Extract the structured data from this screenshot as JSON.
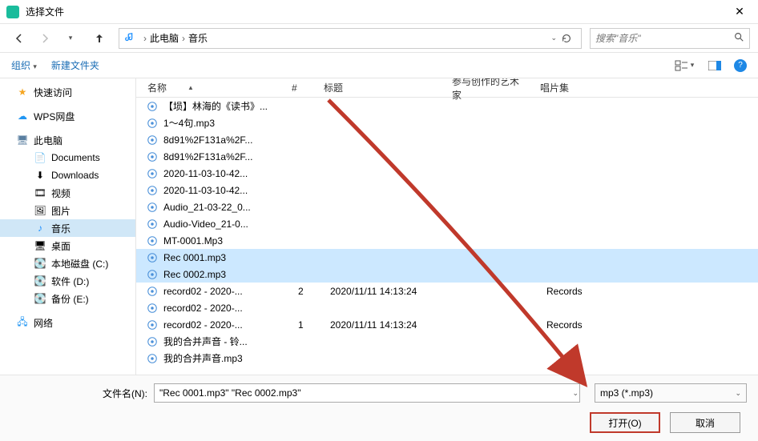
{
  "window": {
    "title": "选择文件"
  },
  "breadcrumb": {
    "root": "此电脑",
    "folder": "音乐"
  },
  "search": {
    "placeholder": "搜索\"音乐\""
  },
  "toolbar": {
    "organize": "组织",
    "newfolder": "新建文件夹"
  },
  "sidebar": {
    "quickaccess": "快速访问",
    "wps": "WPS网盘",
    "thispc": "此电脑",
    "documents": "Documents",
    "downloads": "Downloads",
    "videos": "视频",
    "pictures": "图片",
    "music": "音乐",
    "desktop": "桌面",
    "diskc": "本地磁盘 (C:)",
    "diskd": "软件 (D:)",
    "diske": "备份 (E:)",
    "network": "网络"
  },
  "columns": {
    "name": "名称",
    "num": "#",
    "title": "标题",
    "artist": "参与创作的艺术家",
    "album": "唱片集"
  },
  "files": [
    {
      "name": "【埙】林海的《读书》...",
      "num": "",
      "title": "",
      "album": "",
      "sel": false
    },
    {
      "name": "1～4句.mp3",
      "num": "",
      "title": "",
      "album": "",
      "sel": false
    },
    {
      "name": "8d91%2F131a%2F...",
      "num": "",
      "title": "",
      "album": "",
      "sel": false
    },
    {
      "name": "8d91%2F131a%2F...",
      "num": "",
      "title": "",
      "album": "",
      "sel": false
    },
    {
      "name": "2020-11-03-10-42...",
      "num": "",
      "title": "",
      "album": "",
      "sel": false
    },
    {
      "name": "2020-11-03-10-42...",
      "num": "",
      "title": "",
      "album": "",
      "sel": false
    },
    {
      "name": "Audio_21-03-22_0...",
      "num": "",
      "title": "",
      "album": "",
      "sel": false
    },
    {
      "name": "Audio-Video_21-0...",
      "num": "",
      "title": "",
      "album": "",
      "sel": false
    },
    {
      "name": "MT-0001.Mp3",
      "num": "",
      "title": "",
      "album": "",
      "sel": false
    },
    {
      "name": "Rec 0001.mp3",
      "num": "",
      "title": "",
      "album": "",
      "sel": true
    },
    {
      "name": "Rec 0002.mp3",
      "num": "",
      "title": "",
      "album": "",
      "sel": true
    },
    {
      "name": "record02 - 2020-...",
      "num": "2",
      "title": "2020/11/11 14:13:24",
      "album": "Records",
      "sel": false
    },
    {
      "name": "record02 - 2020-...",
      "num": "",
      "title": "",
      "album": "",
      "sel": false
    },
    {
      "name": "record02 - 2020-...",
      "num": "1",
      "title": "2020/11/11 14:13:24",
      "album": "Records",
      "sel": false
    },
    {
      "name": "我的合并声音 - 铃...",
      "num": "",
      "title": "",
      "album": "",
      "sel": false
    },
    {
      "name": "我的合并声音.mp3",
      "num": "",
      "title": "",
      "album": "",
      "sel": false
    }
  ],
  "bottom": {
    "filename_label": "文件名(N):",
    "filename_value": "\"Rec 0001.mp3\" \"Rec 0002.mp3\"",
    "filter": "mp3 (*.mp3)",
    "open": "打开(O)",
    "cancel": "取消"
  }
}
